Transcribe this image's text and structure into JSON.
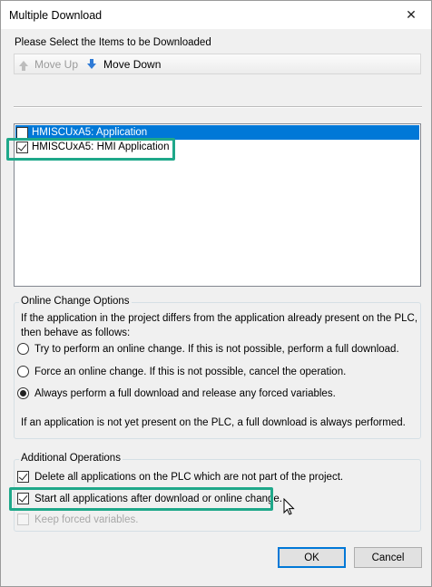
{
  "window": {
    "title": "Multiple Download",
    "close_glyph": "✕"
  },
  "prompt": "Please Select the Items to be Downloaded",
  "toolbar": {
    "move_up": "Move Up",
    "move_down": "Move Down"
  },
  "items": [
    {
      "label": "HMISCUxA5:  Application",
      "checked": false,
      "selected": true
    },
    {
      "label": "HMISCUxA5:  HMI Application",
      "checked": true,
      "selected": false
    }
  ],
  "online_change": {
    "legend": "Online Change Options",
    "description_line1": "If the application in the project differs from the application already present on the PLC,",
    "description_line2": "then behave as follows:",
    "options": [
      {
        "label": "Try to perform an online change. If this is not possible, perform a full download.",
        "selected": false
      },
      {
        "label": "Force an online change. If this is not possible, cancel the operation.",
        "selected": false
      },
      {
        "label": "Always perform a full download and release any forced variables.",
        "selected": true
      }
    ],
    "note": "If an application is not yet present on the PLC, a full download is always performed."
  },
  "additional": {
    "legend": "Additional Operations",
    "options": [
      {
        "label": "Delete all applications on the PLC which are not part of the project.",
        "checked": true,
        "enabled": true
      },
      {
        "label": "Start all applications after download or online change.",
        "checked": true,
        "enabled": true
      },
      {
        "label": "Keep forced variables.",
        "checked": false,
        "enabled": false
      }
    ]
  },
  "buttons": {
    "ok": "OK",
    "cancel": "Cancel"
  },
  "colors": {
    "selection": "#0078d7",
    "highlight": "#1fa88a"
  }
}
